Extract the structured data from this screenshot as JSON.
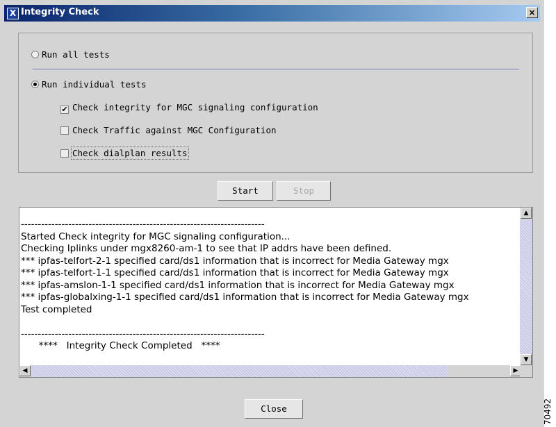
{
  "window": {
    "title": "Integrity Check",
    "title_icon": "X",
    "close_glyph": "×"
  },
  "options": {
    "run_all": {
      "label": "Run all tests",
      "selected": false
    },
    "run_individual": {
      "label": "Run individual tests",
      "selected": true
    },
    "tests": [
      {
        "label": "Check integrity for MGC signaling configuration",
        "checked": true,
        "mark": "✔"
      },
      {
        "label": "Check Traffic against MGC Configuration",
        "checked": false,
        "mark": ""
      },
      {
        "label": "Check dialplan results",
        "checked": false,
        "mark": ""
      }
    ]
  },
  "buttons": {
    "start": "Start",
    "stop": "Stop",
    "close": "Close"
  },
  "log": {
    "lines": [
      "------------------------------------------------------------------------",
      "Started Check integrity for MGC signaling configuration...",
      "Checking Iplinks under mgx8260-am-1 to see that IP addrs have been defined.",
      "*** ipfas-telfort-2-1 specified card/ds1 information that is incorrect for Media Gateway mgx",
      "*** ipfas-telfort-1-1 specified card/ds1 information that is incorrect for Media Gateway mgx",
      "*** ipfas-amslon-1-1 specified card/ds1 information that is incorrect for Media Gateway mgx",
      "*** ipfas-globalxing-1-1 specified card/ds1 information that is incorrect for Media Gateway mgx",
      "Test completed",
      "",
      "------------------------------------------------------------------------",
      "      ****   Integrity Check Completed   ****"
    ]
  },
  "scroll": {
    "up": "▲",
    "down": "▼",
    "left": "◀",
    "right": "▶"
  },
  "figure_id": "70492"
}
